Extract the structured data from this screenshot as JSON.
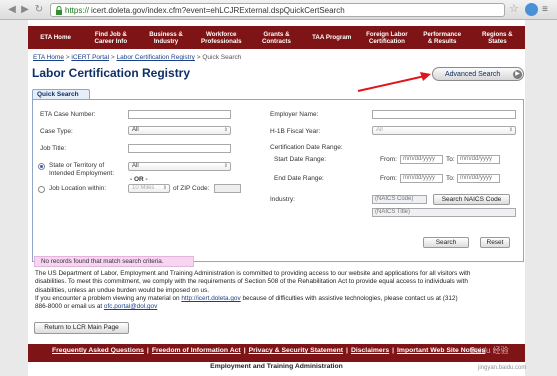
{
  "browser": {
    "url_scheme": "https://",
    "url_rest": "icert.doleta.gov/index.cfm?event=ehLCJRExternal.dspQuickCertSearch"
  },
  "nav": {
    "items": [
      "ETA Home",
      "Find Job &\nCareer Info",
      "Business &\nIndustry",
      "Workforce\nProfessionals",
      "Grants &\nContracts",
      "TAA Program",
      "Foreign Labor\nCertification",
      "Performance\n& Results",
      "Regions &\nStates"
    ]
  },
  "breadcrumb": {
    "items": [
      "ETA Home",
      "iCERT Portal",
      "Labor Certification Registry"
    ],
    "current": "Quick Search",
    "separator": ">"
  },
  "page": {
    "title": "Labor Certification Registry",
    "advanced_search_label": "Advanced Search"
  },
  "tab": {
    "label": "Quick Search"
  },
  "form": {
    "eta_case_number_label": "ETA Case Number:",
    "case_type_label": "Case Type:",
    "case_type_value": "All",
    "job_title_label": "Job Title:",
    "state_label_1": "State or Territory of",
    "state_label_2": "Intended Employment:",
    "state_value": "All",
    "or_label": "- OR -",
    "job_location_label": "Job Location within:",
    "miles_value": "10 Miles",
    "zip_label": "of ZIP Code:",
    "employer_name_label": "Employer Name:",
    "fiscal_year_label": "H-1B Fiscal Year:",
    "fiscal_year_value": "All",
    "cert_date_label": "Certification Date Range:",
    "start_date_label": "Start Date Range:",
    "end_date_label": "End Date Range:",
    "from_label": "From:",
    "to_label": "To:",
    "date_placeholder": "mm/dd/yyyy",
    "industry_label": "Industry:",
    "naics_code_placeholder": "(NAICS Code)",
    "naics_title_placeholder": "(NAICS Title)",
    "search_naics_label": "Search NAICS Code",
    "search_label": "Search",
    "reset_label": "Reset"
  },
  "message": {
    "no_records": "No records found that match search criteria."
  },
  "notice": {
    "line1": "The US Department of Labor, Employment and Training Administration is committed to providing access to our website and applications for all visitors with",
    "line2": "disabilities. To meet this commitment, we comply with the requirements of Section 508 of the Rehabilitation Act to provide equal access to individuals with",
    "line3": "disabilities, unless an undue burden would be imposed on us.",
    "line4_a": "If you encounter a problem viewing any material on ",
    "line4_link": "http://icert.doleta.gov",
    "line4_b": " because of difficulties with assistive technologies, please contact us at (312)",
    "line5_a": "886-8000 or email us at ",
    "line5_link": "ofc.portal@dol.gov"
  },
  "return_button": {
    "label": "Return to LCR Main Page"
  },
  "footer": {
    "links": [
      "Frequently Asked Questions",
      "Freedom of Information Act",
      "Privacy & Security Statement",
      "Disclaimers",
      "Important Web Site Notices"
    ],
    "org": "Employment and Training Administration"
  },
  "watermark": {
    "text": "Baidu 经验",
    "sub": "jingyan.baidu.com"
  },
  "colors": {
    "brand": "#7e1416",
    "title": "#0f2f66",
    "annotation": "#e0141b",
    "no_records_bg": "#f7d4f0"
  }
}
